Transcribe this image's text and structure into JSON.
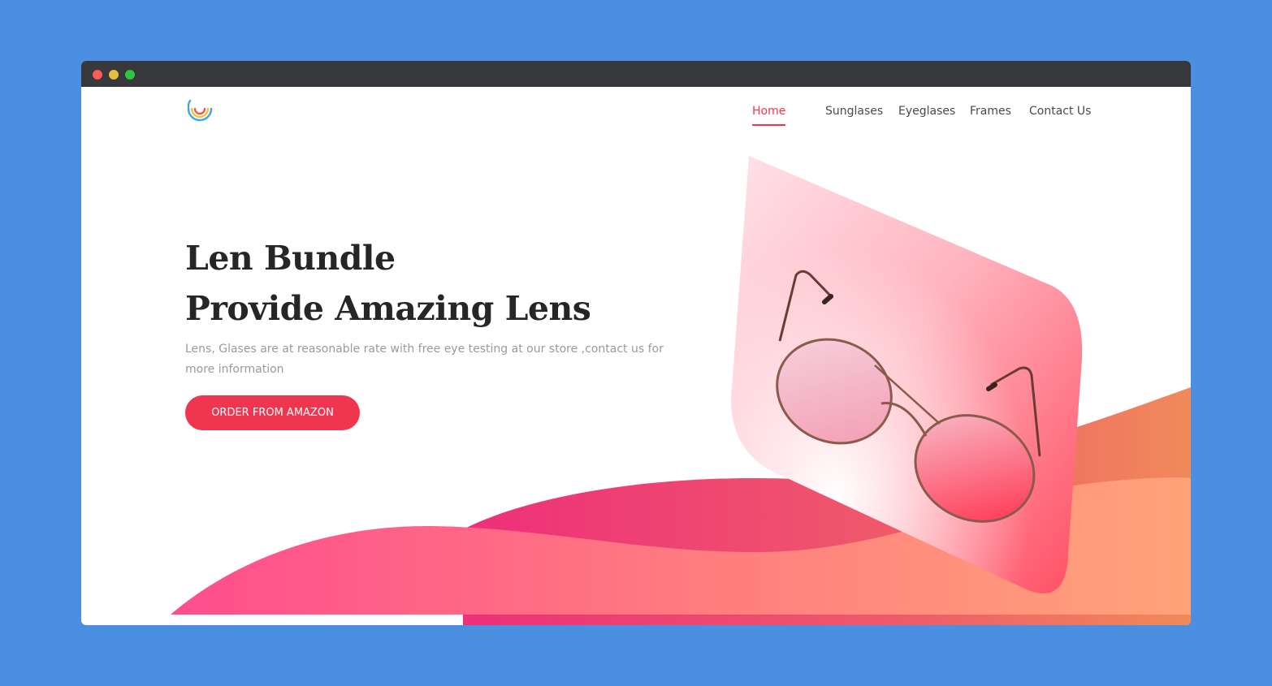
{
  "browser": {
    "controls": [
      "close",
      "minimize",
      "maximize"
    ]
  },
  "header": {
    "logo_icon": "rainbow-arc-logo-icon",
    "nav": [
      {
        "label": "Home",
        "active": true
      },
      {
        "label": "Sunglases",
        "active": false
      },
      {
        "label": "Eyeglases",
        "active": false
      },
      {
        "label": "Frames",
        "active": false
      },
      {
        "label": "Contact Us",
        "active": false
      }
    ]
  },
  "hero": {
    "title_line1": "Len Bundle",
    "title_line2": "Provide Amazing Lens",
    "description": "Lens, Glases are at reasonable rate with free eye testing at our store ,contact us for more information",
    "cta_label": "ORDER FROM AMAZON",
    "image_icon": "sunglasses-product-image"
  },
  "colors": {
    "accent": "#f0364f",
    "window_bg": "#4a8fe0",
    "titlebar": "#37383c",
    "heading": "#262626",
    "body_text": "#9a9a9a"
  }
}
